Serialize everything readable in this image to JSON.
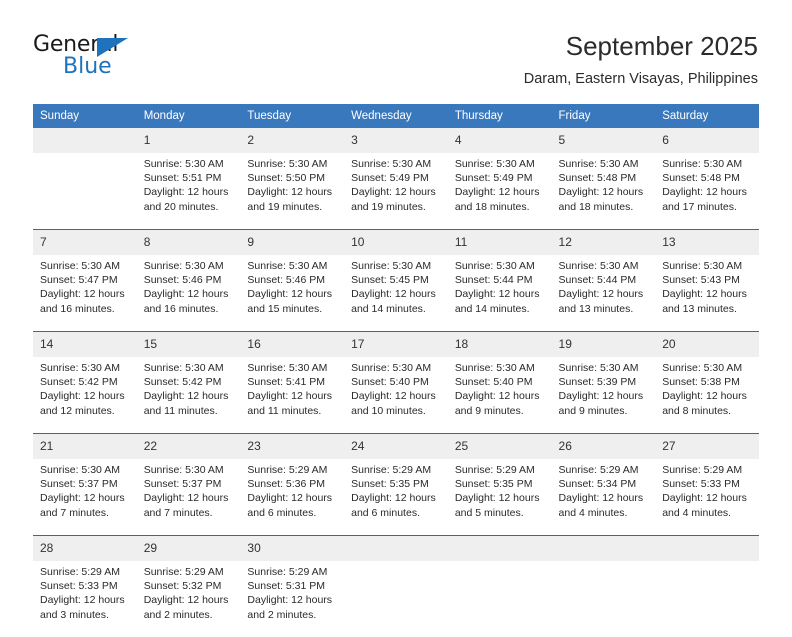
{
  "brand": {
    "name_part1": "General",
    "name_part2": "Blue",
    "accent_color": "#1e73bc"
  },
  "header": {
    "title": "September 2025",
    "subtitle": "Daram, Eastern Visayas, Philippines"
  },
  "theme": {
    "header_blue": "#3a78bd",
    "separator_blue": "#2f6aac",
    "daynum_band": "#efefef",
    "text": "#2a2a2a"
  },
  "weekday_headers": [
    "Sunday",
    "Monday",
    "Tuesday",
    "Wednesday",
    "Thursday",
    "Friday",
    "Saturday"
  ],
  "weeks": [
    {
      "days": [
        {
          "date": "",
          "sunrise": "",
          "sunset": "",
          "daylight_line1": "",
          "daylight_line2": ""
        },
        {
          "date": "1",
          "sunrise": "Sunrise: 5:30 AM",
          "sunset": "Sunset: 5:51 PM",
          "daylight_line1": "Daylight: 12 hours",
          "daylight_line2": "and 20 minutes."
        },
        {
          "date": "2",
          "sunrise": "Sunrise: 5:30 AM",
          "sunset": "Sunset: 5:50 PM",
          "daylight_line1": "Daylight: 12 hours",
          "daylight_line2": "and 19 minutes."
        },
        {
          "date": "3",
          "sunrise": "Sunrise: 5:30 AM",
          "sunset": "Sunset: 5:49 PM",
          "daylight_line1": "Daylight: 12 hours",
          "daylight_line2": "and 19 minutes."
        },
        {
          "date": "4",
          "sunrise": "Sunrise: 5:30 AM",
          "sunset": "Sunset: 5:49 PM",
          "daylight_line1": "Daylight: 12 hours",
          "daylight_line2": "and 18 minutes."
        },
        {
          "date": "5",
          "sunrise": "Sunrise: 5:30 AM",
          "sunset": "Sunset: 5:48 PM",
          "daylight_line1": "Daylight: 12 hours",
          "daylight_line2": "and 18 minutes."
        },
        {
          "date": "6",
          "sunrise": "Sunrise: 5:30 AM",
          "sunset": "Sunset: 5:48 PM",
          "daylight_line1": "Daylight: 12 hours",
          "daylight_line2": "and 17 minutes."
        }
      ]
    },
    {
      "days": [
        {
          "date": "7",
          "sunrise": "Sunrise: 5:30 AM",
          "sunset": "Sunset: 5:47 PM",
          "daylight_line1": "Daylight: 12 hours",
          "daylight_line2": "and 16 minutes."
        },
        {
          "date": "8",
          "sunrise": "Sunrise: 5:30 AM",
          "sunset": "Sunset: 5:46 PM",
          "daylight_line1": "Daylight: 12 hours",
          "daylight_line2": "and 16 minutes."
        },
        {
          "date": "9",
          "sunrise": "Sunrise: 5:30 AM",
          "sunset": "Sunset: 5:46 PM",
          "daylight_line1": "Daylight: 12 hours",
          "daylight_line2": "and 15 minutes."
        },
        {
          "date": "10",
          "sunrise": "Sunrise: 5:30 AM",
          "sunset": "Sunset: 5:45 PM",
          "daylight_line1": "Daylight: 12 hours",
          "daylight_line2": "and 14 minutes."
        },
        {
          "date": "11",
          "sunrise": "Sunrise: 5:30 AM",
          "sunset": "Sunset: 5:44 PM",
          "daylight_line1": "Daylight: 12 hours",
          "daylight_line2": "and 14 minutes."
        },
        {
          "date": "12",
          "sunrise": "Sunrise: 5:30 AM",
          "sunset": "Sunset: 5:44 PM",
          "daylight_line1": "Daylight: 12 hours",
          "daylight_line2": "and 13 minutes."
        },
        {
          "date": "13",
          "sunrise": "Sunrise: 5:30 AM",
          "sunset": "Sunset: 5:43 PM",
          "daylight_line1": "Daylight: 12 hours",
          "daylight_line2": "and 13 minutes."
        }
      ]
    },
    {
      "days": [
        {
          "date": "14",
          "sunrise": "Sunrise: 5:30 AM",
          "sunset": "Sunset: 5:42 PM",
          "daylight_line1": "Daylight: 12 hours",
          "daylight_line2": "and 12 minutes."
        },
        {
          "date": "15",
          "sunrise": "Sunrise: 5:30 AM",
          "sunset": "Sunset: 5:42 PM",
          "daylight_line1": "Daylight: 12 hours",
          "daylight_line2": "and 11 minutes."
        },
        {
          "date": "16",
          "sunrise": "Sunrise: 5:30 AM",
          "sunset": "Sunset: 5:41 PM",
          "daylight_line1": "Daylight: 12 hours",
          "daylight_line2": "and 11 minutes."
        },
        {
          "date": "17",
          "sunrise": "Sunrise: 5:30 AM",
          "sunset": "Sunset: 5:40 PM",
          "daylight_line1": "Daylight: 12 hours",
          "daylight_line2": "and 10 minutes."
        },
        {
          "date": "18",
          "sunrise": "Sunrise: 5:30 AM",
          "sunset": "Sunset: 5:40 PM",
          "daylight_line1": "Daylight: 12 hours",
          "daylight_line2": "and 9 minutes."
        },
        {
          "date": "19",
          "sunrise": "Sunrise: 5:30 AM",
          "sunset": "Sunset: 5:39 PM",
          "daylight_line1": "Daylight: 12 hours",
          "daylight_line2": "and 9 minutes."
        },
        {
          "date": "20",
          "sunrise": "Sunrise: 5:30 AM",
          "sunset": "Sunset: 5:38 PM",
          "daylight_line1": "Daylight: 12 hours",
          "daylight_line2": "and 8 minutes."
        }
      ]
    },
    {
      "days": [
        {
          "date": "21",
          "sunrise": "Sunrise: 5:30 AM",
          "sunset": "Sunset: 5:37 PM",
          "daylight_line1": "Daylight: 12 hours",
          "daylight_line2": "and 7 minutes."
        },
        {
          "date": "22",
          "sunrise": "Sunrise: 5:30 AM",
          "sunset": "Sunset: 5:37 PM",
          "daylight_line1": "Daylight: 12 hours",
          "daylight_line2": "and 7 minutes."
        },
        {
          "date": "23",
          "sunrise": "Sunrise: 5:29 AM",
          "sunset": "Sunset: 5:36 PM",
          "daylight_line1": "Daylight: 12 hours",
          "daylight_line2": "and 6 minutes."
        },
        {
          "date": "24",
          "sunrise": "Sunrise: 5:29 AM",
          "sunset": "Sunset: 5:35 PM",
          "daylight_line1": "Daylight: 12 hours",
          "daylight_line2": "and 6 minutes."
        },
        {
          "date": "25",
          "sunrise": "Sunrise: 5:29 AM",
          "sunset": "Sunset: 5:35 PM",
          "daylight_line1": "Daylight: 12 hours",
          "daylight_line2": "and 5 minutes."
        },
        {
          "date": "26",
          "sunrise": "Sunrise: 5:29 AM",
          "sunset": "Sunset: 5:34 PM",
          "daylight_line1": "Daylight: 12 hours",
          "daylight_line2": "and 4 minutes."
        },
        {
          "date": "27",
          "sunrise": "Sunrise: 5:29 AM",
          "sunset": "Sunset: 5:33 PM",
          "daylight_line1": "Daylight: 12 hours",
          "daylight_line2": "and 4 minutes."
        }
      ]
    },
    {
      "days": [
        {
          "date": "28",
          "sunrise": "Sunrise: 5:29 AM",
          "sunset": "Sunset: 5:33 PM",
          "daylight_line1": "Daylight: 12 hours",
          "daylight_line2": "and 3 minutes."
        },
        {
          "date": "29",
          "sunrise": "Sunrise: 5:29 AM",
          "sunset": "Sunset: 5:32 PM",
          "daylight_line1": "Daylight: 12 hours",
          "daylight_line2": "and 2 minutes."
        },
        {
          "date": "30",
          "sunrise": "Sunrise: 5:29 AM",
          "sunset": "Sunset: 5:31 PM",
          "daylight_line1": "Daylight: 12 hours",
          "daylight_line2": "and 2 minutes."
        },
        {
          "date": "",
          "sunrise": "",
          "sunset": "",
          "daylight_line1": "",
          "daylight_line2": ""
        },
        {
          "date": "",
          "sunrise": "",
          "sunset": "",
          "daylight_line1": "",
          "daylight_line2": ""
        },
        {
          "date": "",
          "sunrise": "",
          "sunset": "",
          "daylight_line1": "",
          "daylight_line2": ""
        },
        {
          "date": "",
          "sunrise": "",
          "sunset": "",
          "daylight_line1": "",
          "daylight_line2": ""
        }
      ]
    }
  ]
}
